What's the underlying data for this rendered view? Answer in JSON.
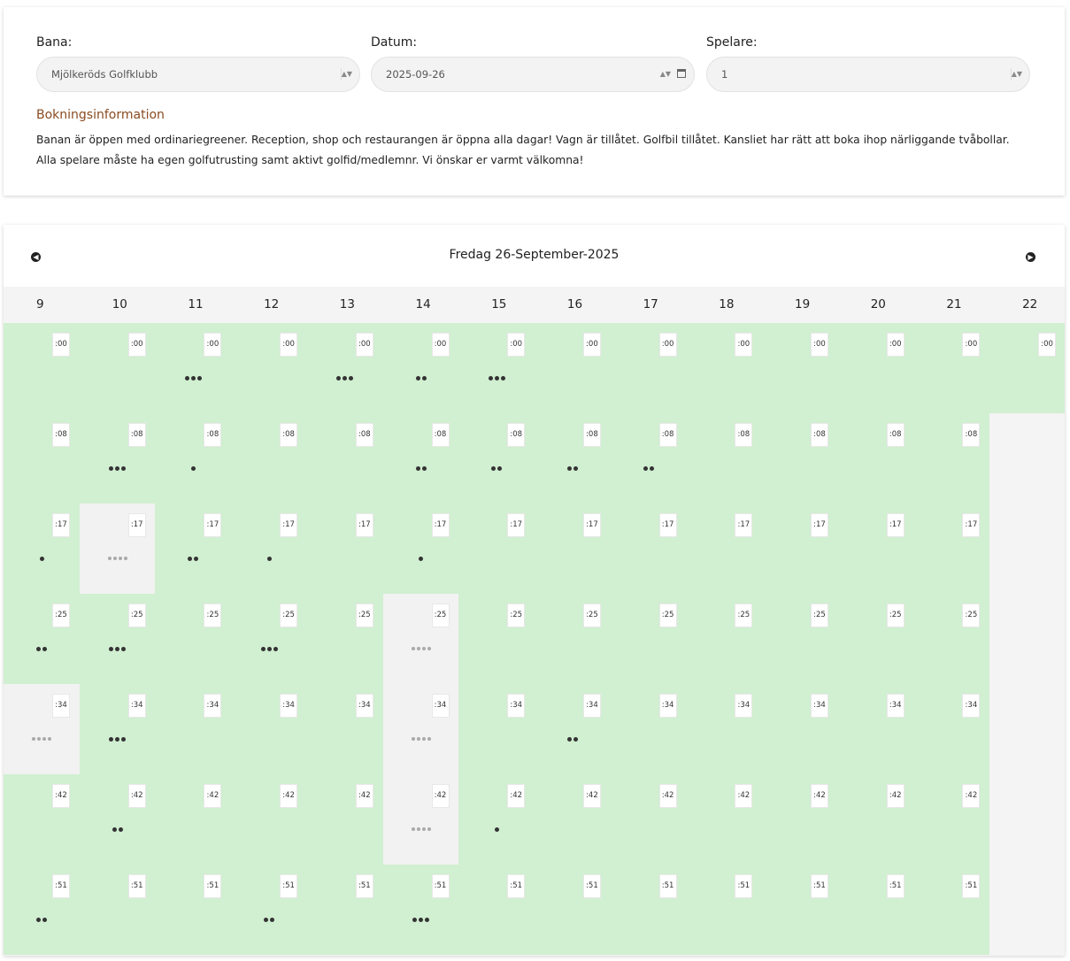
{
  "filters": {
    "bana": {
      "label": "Bana:",
      "value": "Mjölkeröds Golfklubb"
    },
    "datum": {
      "label": "Datum:",
      "value": "2025-09-26"
    },
    "spelare": {
      "label": "Spelare:",
      "value": "1"
    }
  },
  "info": {
    "title": "Bokningsinformation",
    "text": "Banan är öppen med ordinariegreener. Reception, shop och restaurangen är öppna alla dagar! Vagn är tillåtet. Golfbil tillåtet. Kansliet har rätt att boka ihop närliggande tvåbollar. Alla spelare måste ha egen golfutrusting samt aktivt golfid/medlemnr. Vi önskar er varmt välkomna!"
  },
  "calendar": {
    "title": "Fredag 26-September-2025",
    "hours": [
      "9",
      "10",
      "11",
      "12",
      "13",
      "14",
      "15",
      "16",
      "17",
      "18",
      "19",
      "20",
      "21",
      "22"
    ],
    "minutes": [
      ":00",
      ":08",
      ":17",
      ":25",
      ":34",
      ":42",
      ":51"
    ],
    "booked": [
      [
        0,
        0,
        3,
        0,
        3,
        2,
        3,
        0,
        0,
        0,
        0,
        0,
        0,
        0
      ],
      [
        0,
        3,
        1,
        0,
        0,
        2,
        2,
        2,
        2,
        0,
        0,
        0,
        0,
        -1
      ],
      [
        1,
        4,
        2,
        1,
        0,
        1,
        0,
        0,
        0,
        0,
        0,
        0,
        0,
        -1
      ],
      [
        2,
        3,
        0,
        3,
        0,
        4,
        0,
        0,
        0,
        0,
        0,
        0,
        0,
        -1
      ],
      [
        4,
        3,
        0,
        0,
        0,
        4,
        0,
        2,
        0,
        0,
        0,
        0,
        0,
        -1
      ],
      [
        0,
        2,
        0,
        0,
        0,
        4,
        1,
        0,
        0,
        0,
        0,
        0,
        0,
        -1
      ],
      [
        2,
        0,
        0,
        2,
        0,
        3,
        0,
        0,
        0,
        0,
        0,
        0,
        0,
        -1
      ]
    ],
    "capacity": 4
  }
}
